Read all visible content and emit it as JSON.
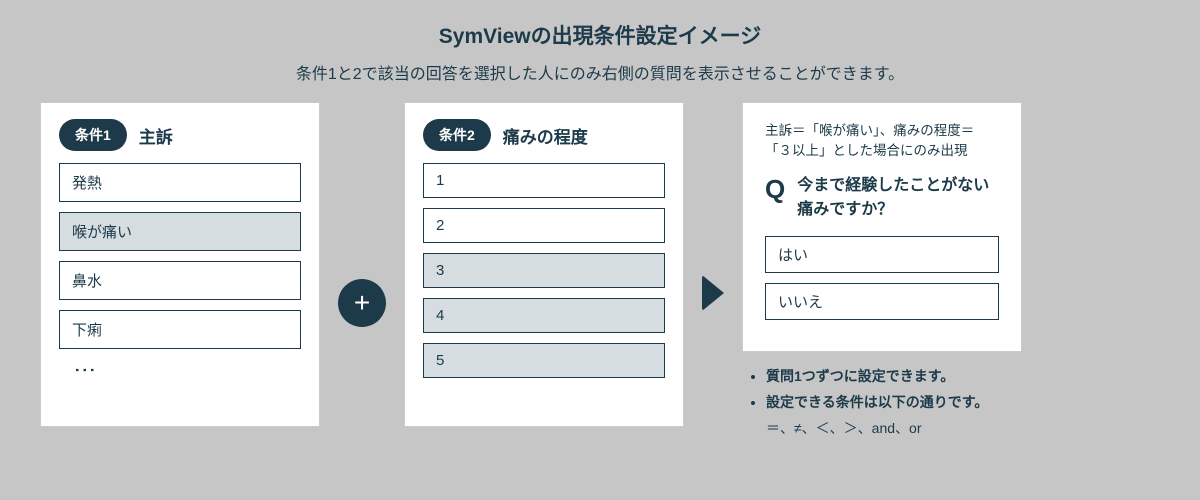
{
  "header": {
    "title": "SymViewの出現条件設定イメージ",
    "subtitle": "条件1と2で該当の回答を選択した人にのみ右側の質問を表示させることができます。"
  },
  "condition1": {
    "pill": "条件1",
    "label": "主訴",
    "options": [
      {
        "label": "発熱",
        "selected": false
      },
      {
        "label": "喉が痛い",
        "selected": true
      },
      {
        "label": "鼻水",
        "selected": false
      },
      {
        "label": "下痢",
        "selected": false
      }
    ]
  },
  "plus": "+",
  "condition2": {
    "pill": "条件2",
    "label": "痛みの程度",
    "options": [
      {
        "label": "1",
        "selected": false
      },
      {
        "label": "2",
        "selected": false
      },
      {
        "label": "3",
        "selected": true
      },
      {
        "label": "4",
        "selected": true
      },
      {
        "label": "5",
        "selected": true
      }
    ]
  },
  "result": {
    "note": "主訴＝「喉が痛い」、痛みの程度＝「３以上」とした場合にのみ出現",
    "q_mark": "Q",
    "question": "今まで経験したことがない痛みですか？",
    "options": [
      {
        "label": "はい"
      },
      {
        "label": "いいえ"
      }
    ]
  },
  "notes": {
    "line1": "質問1つずつに設定できます。",
    "line2": "設定できる条件は以下の通りです。",
    "line3": "＝、≠、＜、＞、and、or"
  }
}
